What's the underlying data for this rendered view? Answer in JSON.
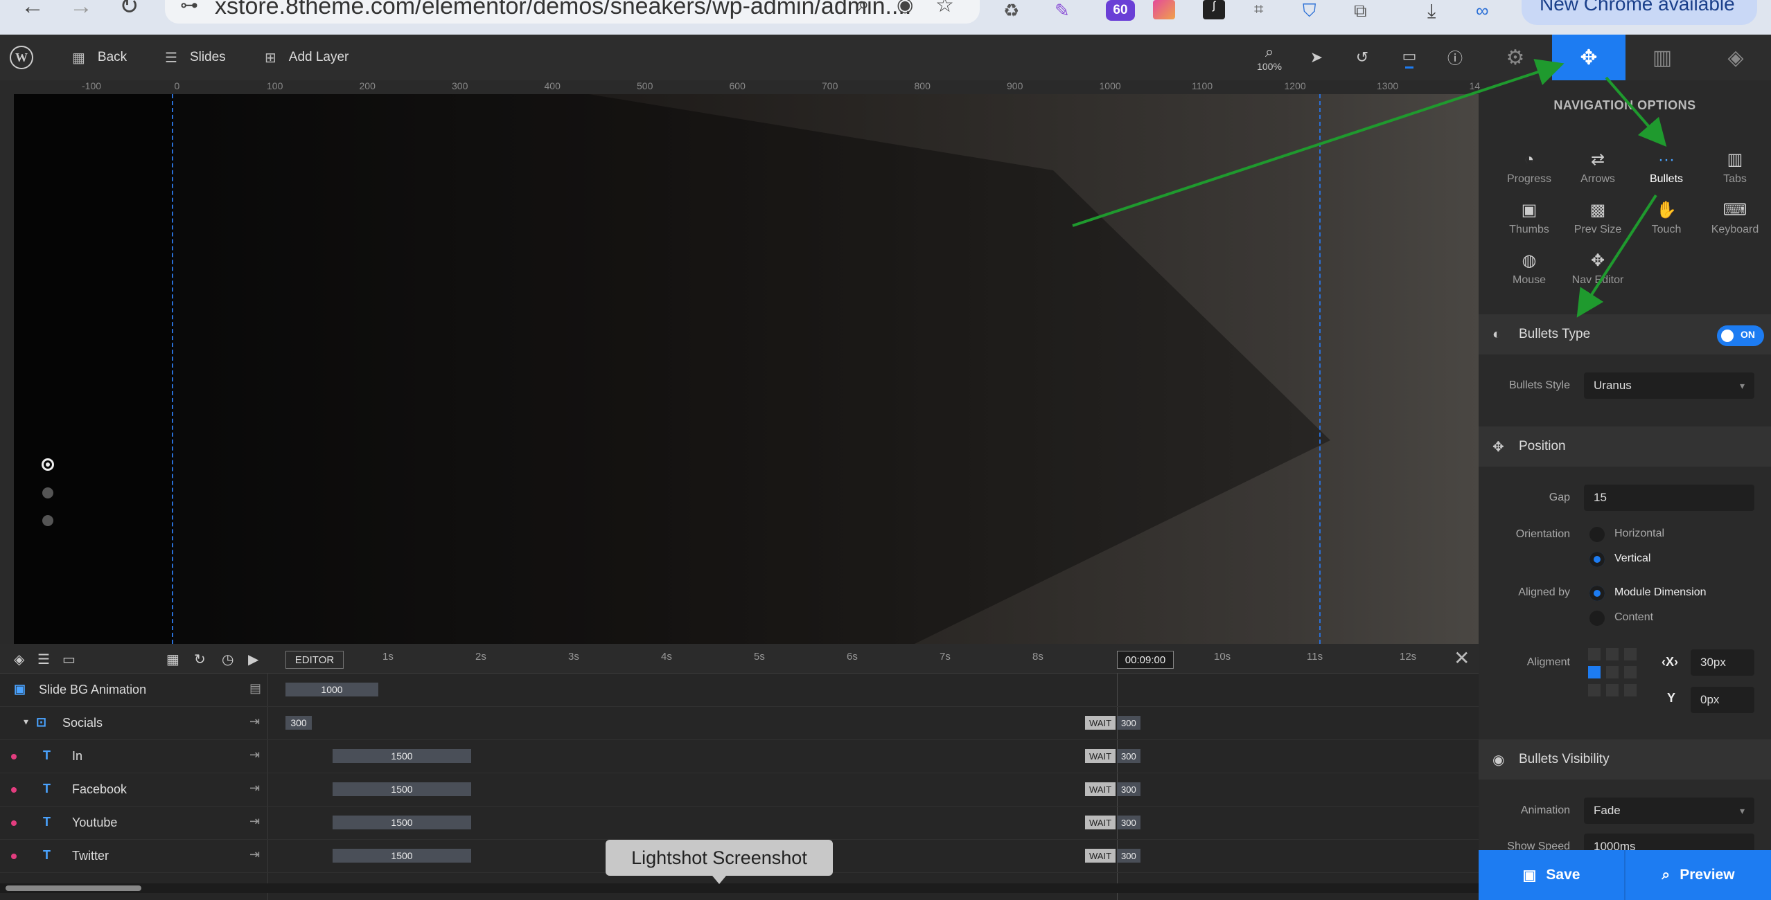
{
  "browser": {
    "url": "xstore.8theme.com/elementor/demos/sneakers/wp-admin/admin....",
    "extension_badge": "60",
    "update_label": "New Chrome available"
  },
  "toolbar": {
    "back_label": "Back",
    "slides_label": "Slides",
    "add_layer_label": "Add Layer",
    "zoom": "100%"
  },
  "ruler": {
    "labels": [
      "-100",
      "0",
      "100",
      "200",
      "300",
      "400",
      "500",
      "600",
      "700",
      "800",
      "900",
      "1000",
      "1100",
      "1200",
      "1300",
      "14"
    ]
  },
  "panel": {
    "title": "NAVIGATION OPTIONS",
    "options": [
      {
        "label": "Progress",
        "icon": "progress-icon"
      },
      {
        "label": "Arrows",
        "icon": "arrows-icon"
      },
      {
        "label": "Bullets",
        "icon": "bullets-icon"
      },
      {
        "label": "Tabs",
        "icon": "tabs-icon"
      },
      {
        "label": "Thumbs",
        "icon": "thumbs-icon"
      },
      {
        "label": "Prev Size",
        "icon": "image-icon"
      },
      {
        "label": "Touch",
        "icon": "hand-icon"
      },
      {
        "label": "Keyboard",
        "icon": "keyboard-icon"
      },
      {
        "label": "Mouse",
        "icon": "mouse-icon"
      },
      {
        "label": "Nav Editor",
        "icon": "nav-editor-icon"
      }
    ],
    "bullets_type": {
      "label": "Bullets Type",
      "toggle": "ON"
    },
    "bullets_style": {
      "label": "Bullets Style",
      "value": "Uranus"
    },
    "position": {
      "label": "Position",
      "gap_label": "Gap",
      "gap_value": "15",
      "orientation_label": "Orientation",
      "orientation_options": [
        "Horizontal",
        "Vertical"
      ],
      "aligned_label": "Aligned by",
      "aligned_options": [
        "Module Dimension",
        "Content"
      ],
      "alignment_label": "Aligment",
      "x_label": "X",
      "x_value": "30px",
      "y_label": "Y",
      "y_value": "0px"
    },
    "visibility": {
      "label": "Bullets Visibility",
      "animation_label": "Animation",
      "animation_value": "Fade",
      "speed_label": "Show Speed",
      "speed_value": "1000ms"
    },
    "save_label": "Save",
    "preview_label": "Preview"
  },
  "timeline": {
    "editor_label": "EDITOR",
    "marks": [
      "1s",
      "2s",
      "3s",
      "4s",
      "5s",
      "6s",
      "7s",
      "8s",
      "10s",
      "11s",
      "12s"
    ],
    "timecode": "00:09:00",
    "rows": [
      {
        "name": "Slide BG Animation",
        "bar": "1000"
      },
      {
        "name": "Socials",
        "bar": "300",
        "wait": "WAIT",
        "end": "300"
      },
      {
        "name": "In",
        "bar": "1500",
        "wait": "WAIT",
        "end": "300"
      },
      {
        "name": "Facebook",
        "bar": "1500",
        "wait": "WAIT",
        "end": "300"
      },
      {
        "name": "Youtube",
        "bar": "1500",
        "wait": "WAIT",
        "end": "300"
      },
      {
        "name": "Twitter",
        "bar": "1500",
        "wait": "WAIT",
        "end": "300"
      }
    ]
  },
  "tooltip": "Lightshot Screenshot",
  "colors": {
    "accent": "#1d7cf2",
    "annotation": "#1f9a2e",
    "layer_dot": "#e33d7f"
  }
}
